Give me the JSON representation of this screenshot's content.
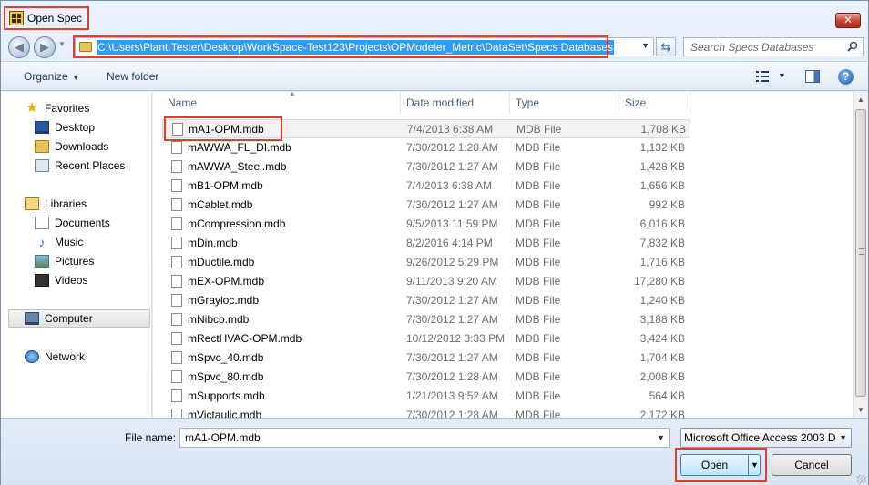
{
  "window": {
    "title": "Open Spec",
    "close_glyph": "✕"
  },
  "address": {
    "path": "C:\\Users\\Plant.Tester\\Desktop\\WorkSpace-Test123\\Projects\\OPModeler_Metric\\DataSet\\Specs Databases",
    "search_placeholder": "Search Specs Databases"
  },
  "toolbar": {
    "organize": "Organize",
    "new_folder": "New folder"
  },
  "navigation": {
    "favorites": "Favorites",
    "desktop": "Desktop",
    "downloads": "Downloads",
    "recent_places": "Recent Places",
    "libraries": "Libraries",
    "documents": "Documents",
    "music": "Music",
    "pictures": "Pictures",
    "videos": "Videos",
    "computer": "Computer",
    "network": "Network"
  },
  "columns": {
    "name": "Name",
    "date": "Date modified",
    "type": "Type",
    "size": "Size"
  },
  "files": [
    {
      "name": "mA1-OPM.mdb",
      "date": "7/4/2013 6:38 AM",
      "type": "MDB File",
      "size": "1,708 KB"
    },
    {
      "name": "mAWWA_FL_DI.mdb",
      "date": "7/30/2012 1:28 AM",
      "type": "MDB File",
      "size": "1,132 KB"
    },
    {
      "name": "mAWWA_Steel.mdb",
      "date": "7/30/2012 1:27 AM",
      "type": "MDB File",
      "size": "1,428 KB"
    },
    {
      "name": "mB1-OPM.mdb",
      "date": "7/4/2013 6:38 AM",
      "type": "MDB File",
      "size": "1,656 KB"
    },
    {
      "name": "mCablet.mdb",
      "date": "7/30/2012 1:27 AM",
      "type": "MDB File",
      "size": "992 KB"
    },
    {
      "name": "mCompression.mdb",
      "date": "9/5/2013 11:59 PM",
      "type": "MDB File",
      "size": "6,016 KB"
    },
    {
      "name": "mDin.mdb",
      "date": "8/2/2016 4:14 PM",
      "type": "MDB File",
      "size": "7,832 KB"
    },
    {
      "name": "mDuctile.mdb",
      "date": "9/26/2012 5:29 PM",
      "type": "MDB File",
      "size": "1,716 KB"
    },
    {
      "name": "mEX-OPM.mdb",
      "date": "9/11/2013 9:20 AM",
      "type": "MDB File",
      "size": "17,280 KB"
    },
    {
      "name": "mGrayloc.mdb",
      "date": "7/30/2012 1:27 AM",
      "type": "MDB File",
      "size": "1,240 KB"
    },
    {
      "name": "mNibco.mdb",
      "date": "7/30/2012 1:27 AM",
      "type": "MDB File",
      "size": "3,188 KB"
    },
    {
      "name": "mRectHVAC-OPM.mdb",
      "date": "10/12/2012 3:33 PM",
      "type": "MDB File",
      "size": "3,424 KB"
    },
    {
      "name": "mSpvc_40.mdb",
      "date": "7/30/2012 1:27 AM",
      "type": "MDB File",
      "size": "1,704 KB"
    },
    {
      "name": "mSpvc_80.mdb",
      "date": "7/30/2012 1:28 AM",
      "type": "MDB File",
      "size": "2,008 KB"
    },
    {
      "name": "mSupports.mdb",
      "date": "1/21/2013 9:52 AM",
      "type": "MDB File",
      "size": "564 KB"
    },
    {
      "name": "mVictaulic.mdb",
      "date": "7/30/2012 1:28 AM",
      "type": "MDB File",
      "size": "2,172 KB"
    }
  ],
  "footer": {
    "file_name_label": "File name:",
    "file_name_value": "mA1-OPM.mdb",
    "file_type": "Microsoft Office Access 2003 D",
    "open_label": "Open",
    "cancel_label": "Cancel"
  },
  "icons": {
    "favorites": "star-icon",
    "desktop": "desktop-icon",
    "downloads": "folder-icon",
    "recent": "recent-places-icon",
    "libraries": "library-icon",
    "documents": "document-icon",
    "music": "music-note-icon",
    "pictures": "pictures-icon",
    "videos": "videos-icon",
    "computer": "computer-icon",
    "network": "network-icon",
    "file": "file-icon"
  },
  "colors": {
    "highlight_border": "#e03c31",
    "selection": "#3399ff"
  }
}
